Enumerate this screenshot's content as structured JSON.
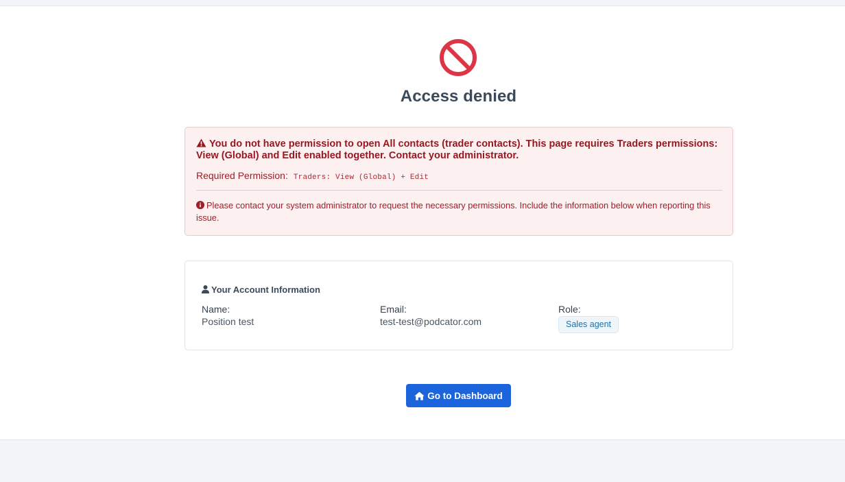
{
  "page": {
    "title": "Access denied"
  },
  "alert": {
    "message": "You do not have permission to open All contacts (trader contacts). This page requires Traders permissions: View (Global) and Edit enabled together. Contact your administrator.",
    "required_label": "Required Permission:",
    "required_code": "Traders: View (Global) + Edit",
    "contact_note": "Please contact your system administrator to request the necessary permissions. Include the information below when reporting this issue."
  },
  "account": {
    "heading": "Your Account Information",
    "name_label": "Name:",
    "name_value": "Position test",
    "email_label": "Email:",
    "email_value": "test-test@podcator.com",
    "role_label": "Role:",
    "role_value": "Sales agent"
  },
  "actions": {
    "dashboard_label": "Go to Dashboard"
  },
  "icons": {
    "denied": "ban-icon",
    "warning": "warning-triangle-icon",
    "info": "info-circle-icon",
    "user": "user-icon",
    "home": "home-icon"
  },
  "colors": {
    "danger": "#dc3545",
    "alert_bg": "#fdf0f1",
    "alert_text": "#97161f",
    "primary": "#1b64dc",
    "badge_bg": "#eef6fc",
    "badge_text": "#1f6fa5"
  }
}
